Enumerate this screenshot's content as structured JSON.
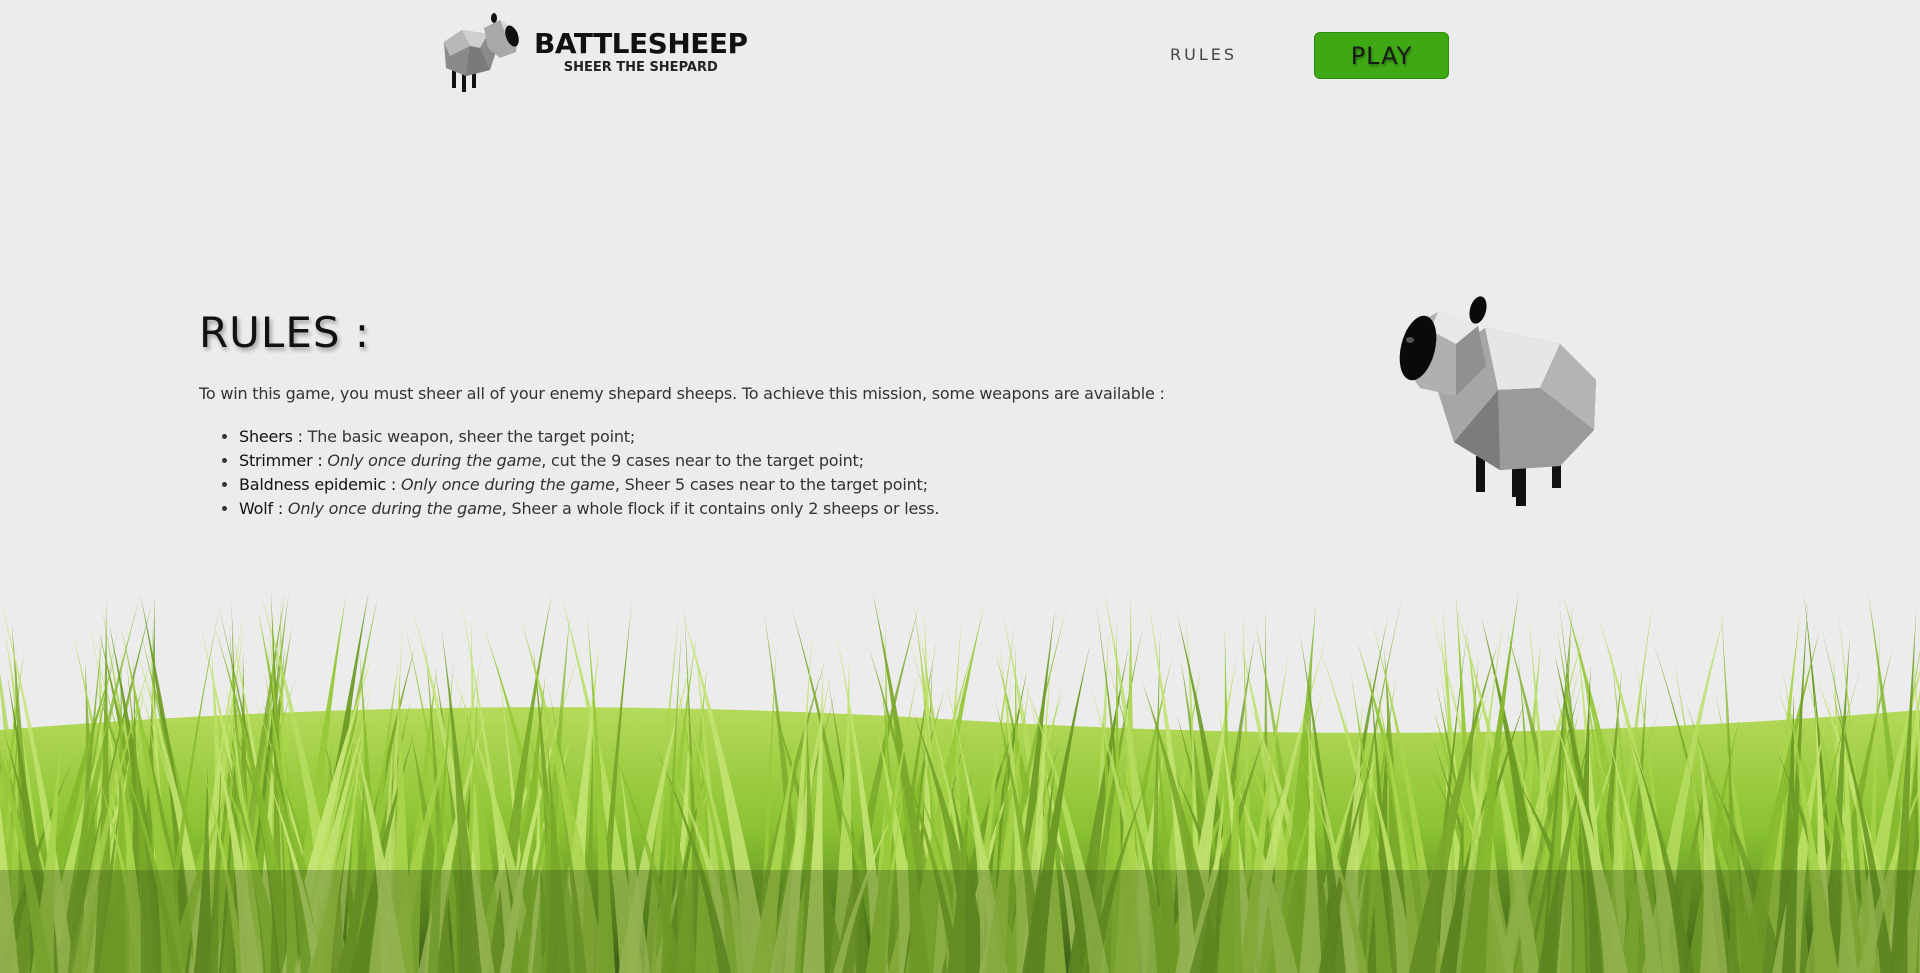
{
  "header": {
    "logo": {
      "title": "BATTLESHEEP",
      "subtitle": "SHEER THE SHEPARD"
    },
    "nav": {
      "rules_label": "RULES",
      "play_label": "PLAY"
    }
  },
  "main": {
    "title": "RULES :",
    "intro": "To win this game, you must sheer all of your enemy shepard sheeps. To achieve this mission, some weapons are available :",
    "weapons": [
      {
        "name": "Sheers :",
        "restriction": "",
        "description": " The basic weapon, sheer the target point;"
      },
      {
        "name": "Strimmer :",
        "restriction": "Only once during the game",
        "description": ", cut the 9 cases near to the target point;"
      },
      {
        "name": "Baldness epidemic :",
        "restriction": "Only once during the game",
        "description": ", Sheer 5 cases near to the target point;"
      },
      {
        "name": "Wolf :",
        "restriction": "Only once during the game",
        "description": ", Sheer a whole flock if it contains only 2 sheeps or less."
      }
    ]
  },
  "colors": {
    "background": "#ececec",
    "play_button": "#3ea815",
    "grass_light": "#9ccc3c",
    "grass_dark": "#4f7a1e"
  },
  "icons": {
    "logo": "sheep-logo-icon",
    "illustration": "sheep-illustration"
  }
}
